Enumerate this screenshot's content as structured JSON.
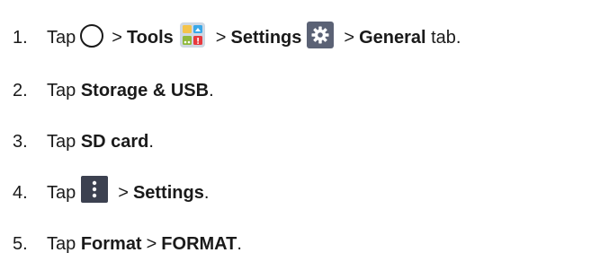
{
  "steps": [
    {
      "number": "1.",
      "text_tap": "Tap",
      "separator": ">",
      "tools": "Tools",
      "settings": "Settings",
      "general": "General",
      "tail": " tab."
    },
    {
      "number": "2.",
      "text_tap": "Tap ",
      "storage": "Storage & USB",
      "tail": "."
    },
    {
      "number": "3.",
      "text_tap": "Tap ",
      "sd_card": "SD card",
      "tail": "."
    },
    {
      "number": "4.",
      "text_tap": "Tap",
      "separator": ">",
      "settings": "Settings",
      "tail": "."
    },
    {
      "number": "5.",
      "text_tap": "Tap ",
      "format": "Format",
      "separator": ">",
      "format_caps": "FORMAT",
      "tail": "."
    }
  ],
  "icons": {
    "home": "home-circle-icon",
    "tools": "tools-folder-icon",
    "settings": "gear-icon",
    "more": "more-vertical-icon"
  },
  "colors": {
    "text": "#1a1a1a",
    "settings_icon_bg": "#5b6275",
    "more_icon_bg": "#3c4150"
  }
}
